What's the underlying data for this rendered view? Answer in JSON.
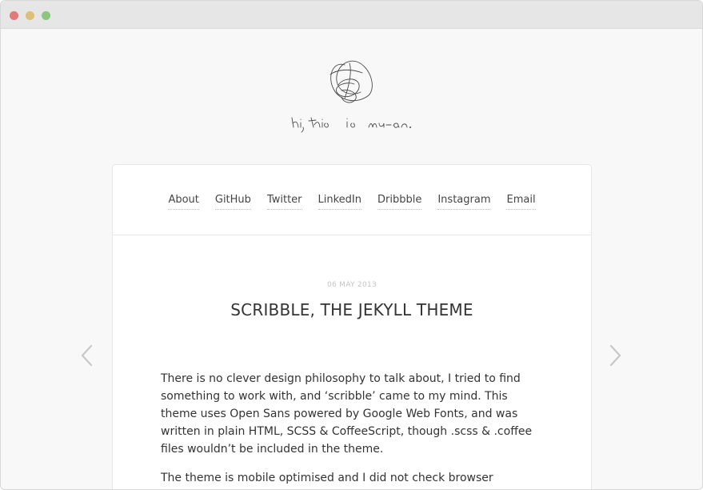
{
  "window": {
    "controls": [
      "close",
      "minimize",
      "zoom"
    ]
  },
  "logo": {
    "alt": "hi, this is mu-an."
  },
  "nav": {
    "items": [
      "About",
      "GitHub",
      "Twitter",
      "LinkedIn",
      "Dribbble",
      "Instagram",
      "Email"
    ]
  },
  "post": {
    "date": "06 MAY 2013",
    "title": "SCRIBBLE, THE JEKYLL THEME",
    "paragraphs": [
      "There is no clever design philosophy to talk about, I tried to find something to work with, and ‘scribble’ came to my mind. This theme uses Open Sans powered by Google Web Fonts, and was written in plain HTML, SCSS & CoffeeScript, though .scss & .coffee files wouldn’t be included in the theme.",
      "The theme is mobile optimised and I did not check browser"
    ]
  },
  "pagination": {
    "prev_icon": "chevron-left-icon",
    "next_icon": "chevron-right-icon"
  },
  "colors": {
    "close": "#e2797a",
    "minimize": "#dcc07a",
    "zoom": "#8ac67e",
    "page_bg": "#f8f8f8",
    "text": "#333333",
    "date": "#c4c4c4"
  }
}
